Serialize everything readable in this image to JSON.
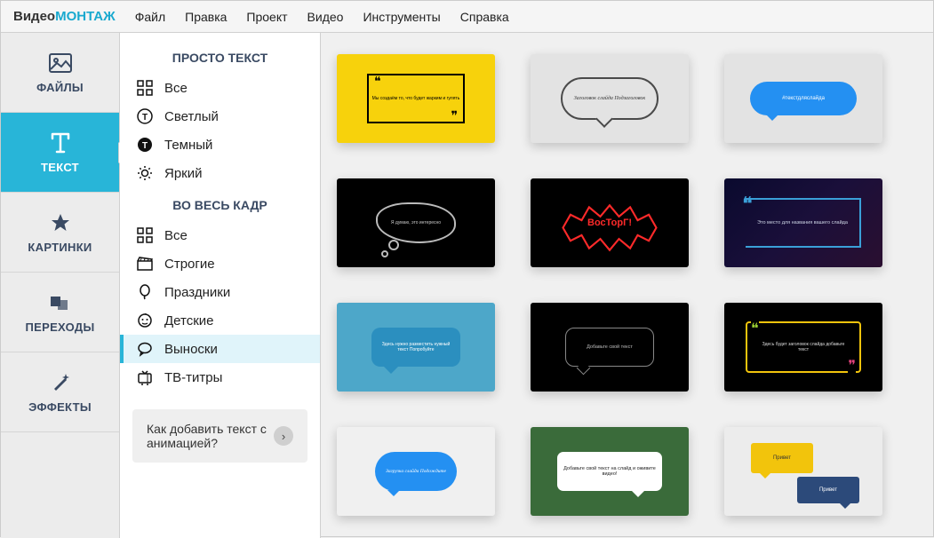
{
  "logo": {
    "part1": "Видео",
    "part2": "МОНТАЖ"
  },
  "menu": [
    "Файл",
    "Правка",
    "Проект",
    "Видео",
    "Инструменты",
    "Справка"
  ],
  "nav": [
    {
      "key": "files",
      "label": "ФАЙЛЫ"
    },
    {
      "key": "text",
      "label": "ТЕКСТ"
    },
    {
      "key": "pictures",
      "label": "КАРТИНКИ"
    },
    {
      "key": "transitions",
      "label": "ПЕРЕХОДЫ"
    },
    {
      "key": "effects",
      "label": "ЭФФЕКТЫ"
    }
  ],
  "groups": {
    "simple": {
      "title": "ПРОСТО ТЕКСТ",
      "items": [
        {
          "key": "all",
          "label": "Все"
        },
        {
          "key": "light",
          "label": "Светлый"
        },
        {
          "key": "dark",
          "label": "Темный"
        },
        {
          "key": "bright",
          "label": "Яркий"
        }
      ]
    },
    "full": {
      "title": "ВО ВЕСЬ КАДР",
      "items": [
        {
          "key": "all2",
          "label": "Все"
        },
        {
          "key": "strict",
          "label": "Строгие"
        },
        {
          "key": "holidays",
          "label": "Праздники"
        },
        {
          "key": "kids",
          "label": "Детские"
        },
        {
          "key": "callouts",
          "label": "Выноски"
        },
        {
          "key": "tv",
          "label": "ТВ-титры"
        }
      ]
    }
  },
  "help": {
    "text": "Как добавить текст с анимацией?",
    "arrow": "›"
  },
  "thumbs": {
    "t1": "Мы создаём то,\nчто будет жарким\nи гулять",
    "t2": "Заголовок слайда\nПодзаголовок",
    "t3": "#текстдляслайда",
    "t4": "Я думаю,\nэто интересно",
    "t5": "ВосТорГ!",
    "t6": "Это место для названия\nвашего слайда",
    "t7": "Здесь нужно\nразместить нужный\nтекст\nПопробуйте",
    "t8": "Добавьте\nсвой текст",
    "t9": "Здесь будет\nзаголовок слайда\nдобавьте текст",
    "t10": "Загрузка слайда\nПодождите",
    "t11": "Добавьте свой текст\nна слайд и оживите видео!",
    "t12a": "Привет",
    "t12b": "Привет"
  }
}
